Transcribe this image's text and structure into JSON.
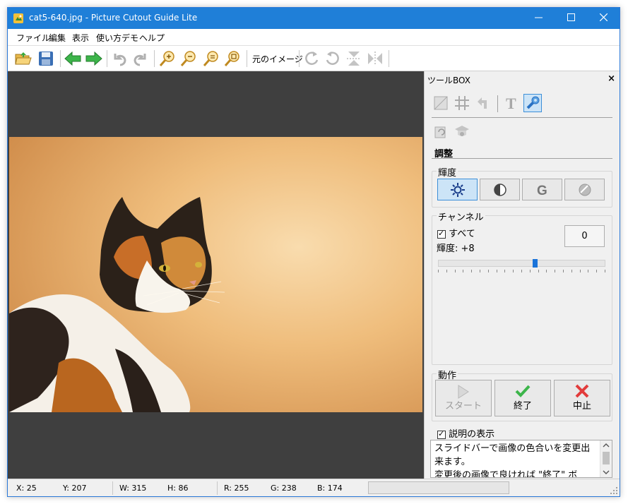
{
  "window": {
    "title": "cat5-640.jpg - Picture Cutout Guide Lite"
  },
  "menu": [
    "ファイル",
    "編集",
    "表示",
    "使い方デモ",
    "ヘルプ"
  ],
  "toolbar": {
    "original_image_label": "元のイメージ"
  },
  "toolbox": {
    "title": "ツールBOX",
    "section_title": "調整",
    "brightness_group": "輝度",
    "channel_group": "チャンネル",
    "all_checkbox": "すべて",
    "brightness_value": "輝度: +8",
    "numeric_value": "0",
    "slider_fraction": 0.58,
    "action_group": "動作",
    "start_label": "スタート",
    "finish_label": "終了",
    "cancel_label": "中止",
    "show_description": "説明の表示",
    "description_lines": [
      "スライドバーで画像の色合いを変更出",
      "来ます。",
      "変更後の画像で良ければ \"終了\" ボ"
    ]
  },
  "status": {
    "x": "X: 25",
    "y": "Y: 207",
    "w": "W: 315",
    "h": "H: 86",
    "r": "R: 255",
    "g": "G: 238",
    "b": "B: 174"
  },
  "colors": {
    "titlebar": "#1f7fd8",
    "canvas": "#3f3f3f",
    "accent": "#1a73d9"
  },
  "icons": [
    "open-folder-icon",
    "save-icon",
    "back-arrow-icon",
    "forward-arrow-icon",
    "undo-icon",
    "redo-icon",
    "zoom-in-icon",
    "zoom-out-icon",
    "zoom-fit-icon",
    "zoom-actual-icon",
    "rotate-right-icon",
    "rotate-left-icon",
    "flip-vertical-icon",
    "flip-horizontal-icon"
  ]
}
